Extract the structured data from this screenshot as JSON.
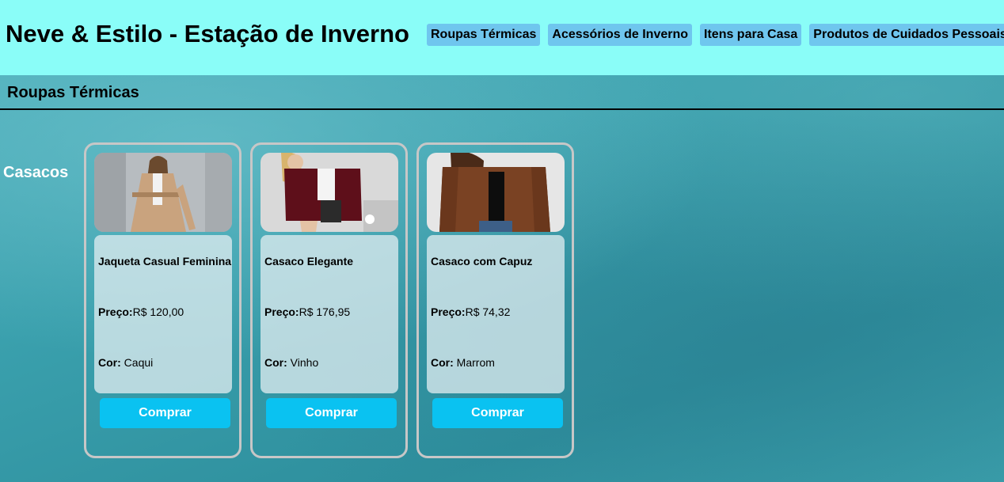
{
  "header": {
    "title": "Neve & Estilo - Estação de Inverno",
    "nav": [
      {
        "label": "Roupas Térmicas"
      },
      {
        "label": "Acessórios de Inverno"
      },
      {
        "label": "Itens para Casa"
      },
      {
        "label": "Produtos de Cuidados Pessoais"
      }
    ]
  },
  "section": {
    "title": "Roupas Térmicas"
  },
  "category": {
    "title": "Casacos"
  },
  "labels": {
    "price": "Preço:",
    "color": "Cor:",
    "buy": "Comprar"
  },
  "products": [
    {
      "name": "Jaqueta Casual Feminina",
      "price": "R$ 120,00",
      "color": "Caqui",
      "coat_color": "#c9a37e",
      "bg_color": "#b7bcc0"
    },
    {
      "name": "Casaco Elegante",
      "price": "R$ 176,95",
      "color": "Vinho",
      "coat_color": "#5e0f1a",
      "bg_color": "#d9d9d9"
    },
    {
      "name": "Casaco com Capuz",
      "price": "R$ 74,32",
      "color": "Marrom",
      "coat_color": "#7a4223",
      "bg_color": "#e6e6e6"
    }
  ],
  "colors": {
    "header_bg": "#8afdf8",
    "nav_bg": "#6fc6ee",
    "buy_bg": "#0ac2f1"
  }
}
